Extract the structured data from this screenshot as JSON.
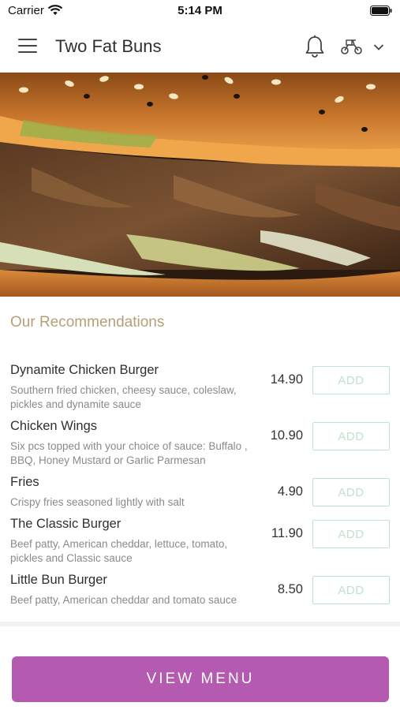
{
  "status_bar": {
    "carrier": "Carrier",
    "time": "5:14 PM"
  },
  "header": {
    "title": "Two Fat Buns",
    "icons": [
      "menu-icon",
      "bell-icon",
      "delivery-scooter-icon",
      "chevron-down-icon"
    ]
  },
  "section": {
    "title": "Our Recommendations"
  },
  "menu_items": [
    {
      "name": "Dynamite Chicken Burger",
      "description": "Southern fried chicken, cheesy sauce, coleslaw, pickles and dynamite sauce",
      "price": "14.90",
      "add_label": "ADD"
    },
    {
      "name": "Chicken Wings",
      "description": "Six pcs topped with your choice of sauce: Buffalo , BBQ, Honey Mustard or Garlic Parmesan",
      "price": "10.90",
      "add_label": "ADD"
    },
    {
      "name": "Fries",
      "description": "Crispy fries seasoned lightly with salt",
      "price": "4.90",
      "add_label": "ADD"
    },
    {
      "name": "The Classic Burger",
      "description": "Beef patty, American cheddar, lettuce, tomato, pickles and Classic sauce",
      "price": "11.90",
      "add_label": "ADD"
    },
    {
      "name": "Little Bun Burger",
      "description": "Beef patty, American cheddar and tomato sauce",
      "price": "8.50",
      "add_label": "ADD"
    }
  ],
  "cta": {
    "label": "VIEW MENU"
  },
  "colors": {
    "accent": "#b45ab0",
    "section_title": "#b4a07a",
    "add_button": "#bfe3cf"
  }
}
